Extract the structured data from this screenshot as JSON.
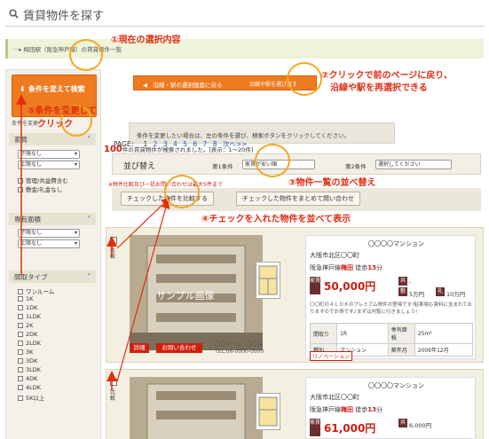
{
  "header": {
    "title": "賃貸物件を探す",
    "icon": "search-icon"
  },
  "breadcrumb": "梅田駅（阪急神戸線）の賃貸物件一覧",
  "sidebar": {
    "change_button": "条件を変えて検索",
    "note": "条件を変更",
    "sections": [
      {
        "title": "家賃",
        "toggle": "«",
        "selects": [
          "下限なし",
          "上限なし"
        ],
        "checks": [
          "管理/共益費含む",
          "敷金/礼金なし"
        ]
      },
      {
        "title": "専有面積",
        "toggle": "«",
        "selects": [
          "下限なし",
          "上限なし"
        ],
        "checks": []
      },
      {
        "title": "間取タイプ",
        "toggle": "«",
        "selects": [],
        "checks": [
          "ワンルーム",
          "1K",
          "1DK",
          "1LDK",
          "2K",
          "2DK",
          "2LDK",
          "3K",
          "3DK",
          "3LDK",
          "4DK",
          "4LDK",
          "5K以上"
        ]
      }
    ]
  },
  "back_button": {
    "label": "沿線・駅の選択画面に戻る",
    "sub": "沿線や駅を選び直す"
  },
  "info_text": "条件を変更したい場合は、左の条件を選び、検索ボタンをクリックしてください。",
  "count": {
    "number": "100",
    "suffix": "件の賃貸物件が検索されました。[表示：1〜20件]"
  },
  "pager": {
    "label": "PAGE：",
    "current": "1",
    "pages": [
      "2",
      "3",
      "4",
      "5",
      "6",
      "7",
      "8"
    ],
    "next": "次へ>>"
  },
  "sort": {
    "title": "並び替え",
    "cond1_label": "第1条件",
    "cond1_value": "家賃が安い順",
    "cond2_label": "第2条件",
    "cond2_value": "選択してください"
  },
  "warning": "※物件比較及び一括お問い合わせは最大5件まで",
  "compare_buttons": [
    "チェックした物件を比較する",
    "チェックした物件をまとめて問い合わせ"
  ],
  "listings": [
    {
      "name": "〇〇〇〇マンション",
      "address": "大阪市北区〇〇町",
      "line": "阪急神戸線",
      "station": "梅田",
      "walk_pre": "徒歩",
      "walk_num": "13",
      "walk_unit": "分",
      "rent_tag": "家賃",
      "rent": "50,000円",
      "fee_tag": "共",
      "fee": "-",
      "deposit_tag": "敷",
      "deposit": "5万円",
      "key_tag": "礼",
      "key_money": "10万円",
      "description": "〇〇町の４ＬＤＫのプレミアム物件の登場です!駐車場も賃料に含まれておりますのでお得です♪まずは内覧に行きましょう!",
      "specs": [
        [
          "間取り",
          "1R",
          "専有面積",
          "25m²"
        ],
        [
          "種別",
          "マンション",
          "築年月",
          "2009年12月"
        ]
      ],
      "badge": "リノベーション",
      "photo_label": "サンプル画像",
      "detail_button": "詳細",
      "inquiry_button": "お問い合わせ",
      "agency": "〇〇ホーム　〇〇店",
      "tel": "TEL.06-0000-0000",
      "compare_label": "比較"
    },
    {
      "name": "〇〇〇〇マンション",
      "address": "大阪市北区〇〇町",
      "line": "阪急神戸線",
      "station": "梅田",
      "walk_pre": "徒歩",
      "walk_num": "13",
      "walk_unit": "分",
      "rent_tag": "家賃",
      "rent": "61,000円",
      "fee_tag": "共",
      "fee": "6,000円",
      "compare_label": "比較"
    }
  ],
  "annotations": {
    "a1": "①現在の選択内容",
    "a2_line1": "②クリックで前のページに戻り、",
    "a2_line2": "沿線や駅を再選択できる",
    "a3": "③物件一覧の並べ替え",
    "a4": "④チェックを入れた物件を並べて表示",
    "a5_line1": "⑤条件を変更して",
    "a5_line2": "クリック",
    "color": "#e12d12",
    "circle_color": "#f4a61f"
  }
}
